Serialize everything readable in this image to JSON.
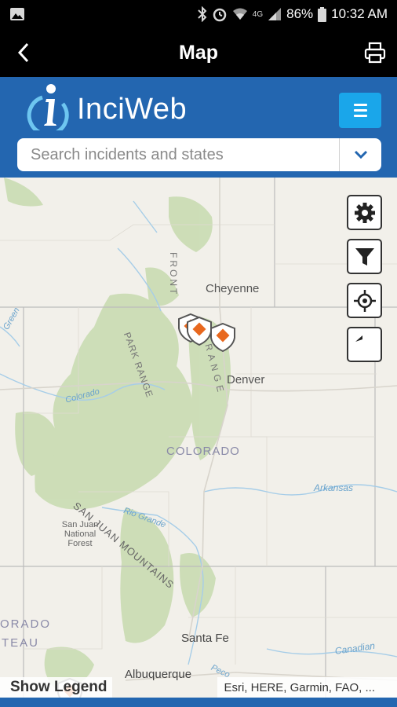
{
  "status_bar": {
    "battery": "86%",
    "time": "10:32 AM",
    "network": "4G",
    "icons": [
      "image-icon",
      "bluetooth-icon",
      "alarm-icon",
      "wifi-icon",
      "signal-icon",
      "battery-icon"
    ]
  },
  "title_bar": {
    "title": "Map",
    "back_icon": "chevron-left-icon",
    "print_icon": "printer-icon"
  },
  "header": {
    "brand": "InciWeb",
    "logo_icon": "inciweb-info-logo",
    "menu_icon": "hamburger-icon",
    "search": {
      "placeholder": "Search incidents and states",
      "value": ""
    },
    "search_toggle_icon": "chevron-down-icon"
  },
  "map": {
    "labels": {
      "cheyenne": "Cheyenne",
      "denver": "Denver",
      "colorado": "COLORADO",
      "front": "FRONT",
      "range_range": "RANGE",
      "park_range": "PARK RANGE",
      "san_juan_mountains": "SAN JUAN MOUNTAINS",
      "san_juan_forest": "San Juan National Forest",
      "arkansas": "Arkansas",
      "rio_grande": "Rio Grande",
      "colorado_river": "Colorado",
      "santa_fe": "Santa Fe",
      "albuquerque": "Albuquerque",
      "canadian": "Canadian",
      "green": "Green",
      "orado": "ORADO",
      "teau": "TEAU",
      "pecos": "Peco"
    },
    "controls": [
      {
        "name": "settings-button",
        "icon": "gear-icon"
      },
      {
        "name": "filter-button",
        "icon": "filter-icon"
      },
      {
        "name": "locate-button",
        "icon": "crosshair-icon"
      },
      {
        "name": "undo-button",
        "icon": "undo-arrow-icon"
      }
    ],
    "incident_markers": 4,
    "marker_color": "#e8681e",
    "show_legend": "Show Legend",
    "attribution": "Esri, HERE, Garmin, FAO, ..."
  },
  "colors": {
    "header_blue": "#2366b0",
    "menu_button": "#1aa6ea",
    "map_land": "#f2f0ea",
    "forest": "#c9dcb2"
  }
}
